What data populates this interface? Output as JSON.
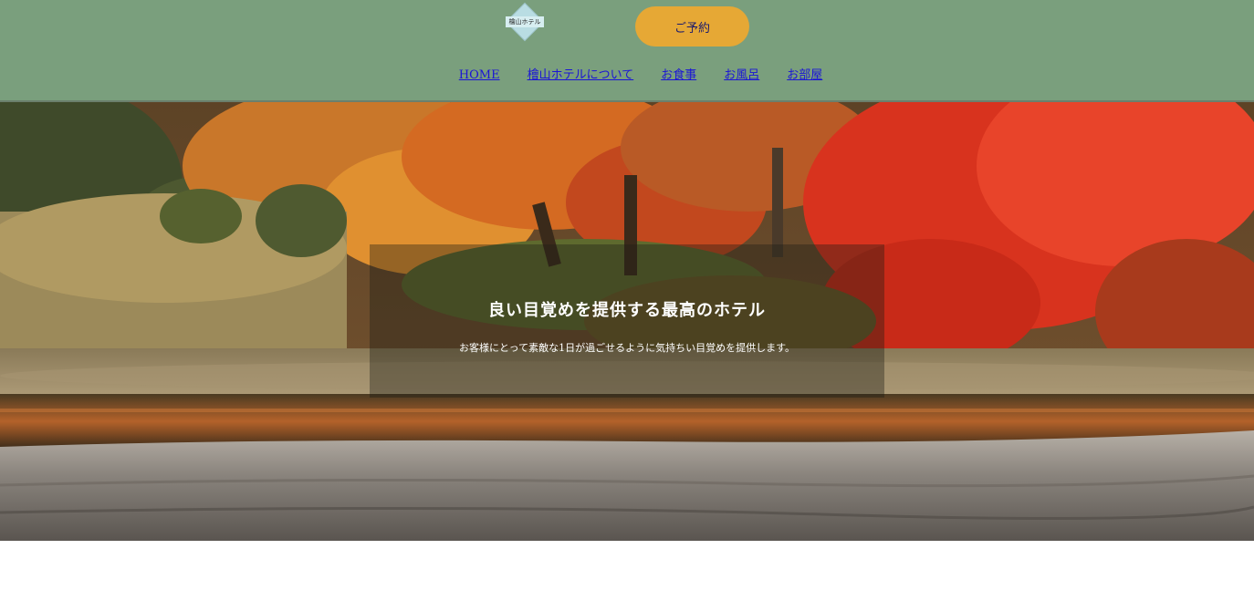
{
  "header": {
    "logo_text": "檜山ホテル",
    "reserve_label": "ご予約",
    "nav": [
      "HOME",
      "檜山ホテルについて",
      "お食事",
      "お風呂",
      "お部屋"
    ]
  },
  "hero": {
    "title": "良い目覚めを提供する最高のホテル",
    "subtitle": "お客様にとって素敵な1日が過ごせるように気持ちい目覚めを提供します。"
  },
  "colors": {
    "header_bg": "#7a9f7d",
    "reserve_bg": "#e6a835",
    "nav_link": "#1a14d6"
  }
}
